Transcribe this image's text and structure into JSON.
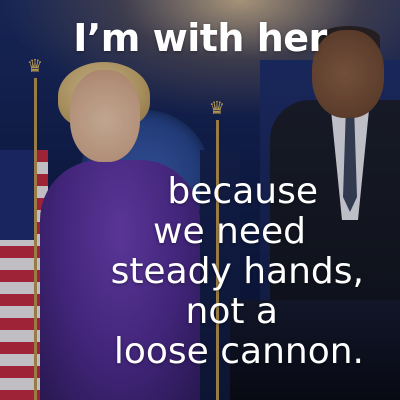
{
  "headline": "I’m with her",
  "caption": {
    "lines": [
      "because",
      "we need",
      "steady hands,",
      "not a",
      "loose cannon."
    ]
  },
  "colors": {
    "text": "#ffffff",
    "background": "#0f1c48",
    "jacket": "#4e2a8c"
  },
  "icons": {
    "eagle": "eagle-finial-icon"
  }
}
